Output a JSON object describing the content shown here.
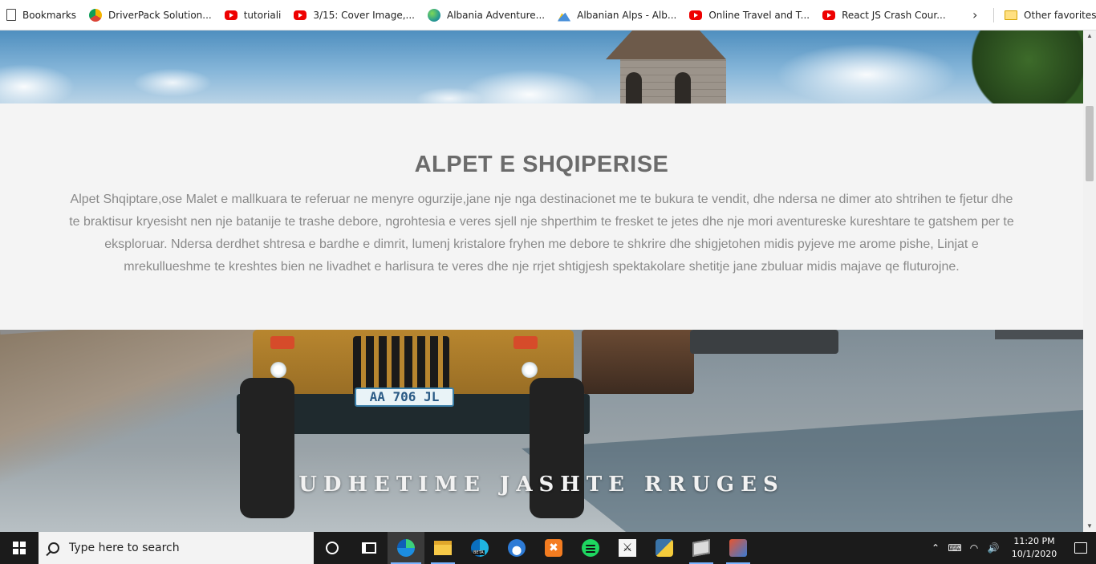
{
  "bookmarks_bar": {
    "items": [
      {
        "label": "Bookmarks",
        "icon": "page-icon"
      },
      {
        "label": "DriverPack Solution...",
        "icon": "driverpack-icon"
      },
      {
        "label": "tutoriali",
        "icon": "youtube-icon"
      },
      {
        "label": "3/15: Cover Image,...",
        "icon": "youtube-icon"
      },
      {
        "label": "Albania Adventure...",
        "icon": "globe-icon"
      },
      {
        "label": "Albanian Alps - Alb...",
        "icon": "mountain-icon"
      },
      {
        "label": "Online Travel and T...",
        "icon": "youtube-icon"
      },
      {
        "label": "React JS Crash Cour...",
        "icon": "youtube-icon"
      }
    ],
    "overflow_icon": "chevron-right-icon",
    "other_favorites": "Other favorites"
  },
  "page": {
    "intro": {
      "title": "ALPET E SHQIPERISE",
      "text": "Alpet Shqiptare,ose Malet e mallkuara te referuar ne menyre ogurzije,jane nje nga destinacionet me te bukura te vendit, dhe ndersa ne dimer ato shtrihen te fjetur dhe te braktisur kryesisht nen nje batanije te trashe debore, ngrohtesia e veres sjell nje shperthim te fresket te jetes dhe nje mori aventureske kureshtare te gatshem per te eksploruar. Ndersa derdhet shtresa e bardhe e dimrit, lumenj kristalore fryhen me debore te shkrire dhe shigjetohen midis pyjeve me arome pishe, Linjat e mrekullueshme te kreshtes bien ne livadhet e harlisura te veres dhe nje rrjet shtigjesh spektakolare shetitje jane zbuluar midis majave qe fluturojne."
    },
    "offroad": {
      "title": "UDHETIME JASHTE RRUGES",
      "plate": "AA 706 JL"
    }
  },
  "taskbar": {
    "search_placeholder": "Type here to search",
    "apps": [
      "cortana-icon",
      "task-view-icon",
      "edge-icon",
      "file-explorer-icon",
      "edge-beta-icon",
      "arc-icon",
      "xampp-icon",
      "spotify-icon",
      "counter-strike-icon",
      "python-icon",
      "virtualbox-icon",
      "tool-icon"
    ],
    "time": "11:20 PM",
    "date": "10/1/2020"
  }
}
